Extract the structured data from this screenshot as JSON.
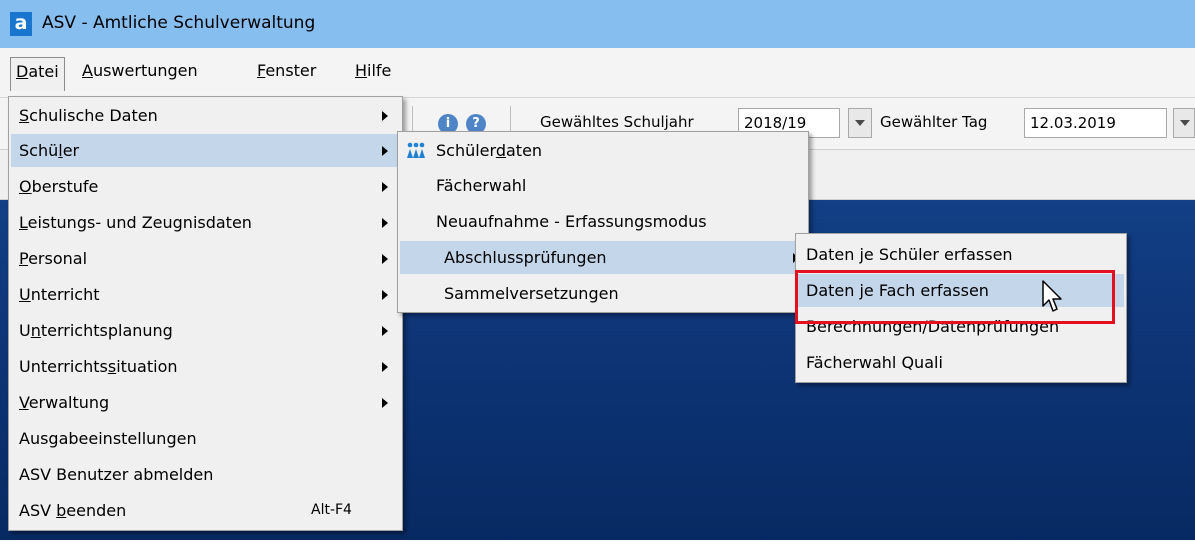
{
  "window": {
    "title": "ASV - Amtliche Schulverwaltung",
    "logo_letter": "a"
  },
  "menubar": {
    "items": [
      {
        "pre": "",
        "key": "D",
        "post": "atei"
      },
      {
        "pre": "",
        "key": "A",
        "post": "uswertungen"
      },
      {
        "pre": "",
        "key": "F",
        "post": "enster"
      },
      {
        "pre": "",
        "key": "H",
        "post": "ilfe"
      }
    ]
  },
  "toolbar": {
    "schuljahr_label": "Gewähltes Schuljahr",
    "schuljahr_value": "2018/19",
    "tag_label": "Gewählter Tag",
    "tag_value": "12.03.2019"
  },
  "datei_menu": [
    {
      "pre": "",
      "key": "S",
      "post": "chulische Daten",
      "submenu": true
    },
    {
      "pre": "Schü",
      "key": "l",
      "post": "er",
      "submenu": true
    },
    {
      "pre": "",
      "key": "O",
      "post": "berstufe",
      "submenu": true
    },
    {
      "pre": "",
      "key": "L",
      "post": "eistungs- und Zeugnisdaten",
      "submenu": true
    },
    {
      "pre": "",
      "key": "P",
      "post": "ersonal",
      "submenu": true
    },
    {
      "pre": "",
      "key": "U",
      "post": "nterricht",
      "submenu": true
    },
    {
      "pre": "U",
      "key": "n",
      "post": "terrichtsplanung",
      "submenu": true
    },
    {
      "pre": "Unterrichts",
      "key": "s",
      "post": "ituation",
      "submenu": true
    },
    {
      "pre": "",
      "key": "V",
      "post": "erwaltung",
      "submenu": true
    },
    {
      "pre": "Ausgabeeinstellungen",
      "key": "",
      "post": "",
      "submenu": false
    },
    {
      "pre": "ASV Benutzer abmelden",
      "key": "",
      "post": "",
      "submenu": false
    },
    {
      "pre": "ASV ",
      "key": "b",
      "post": "eenden",
      "submenu": false,
      "shortcut": "Alt-F4"
    }
  ],
  "schueler_menu": [
    {
      "pre": "Schüler",
      "key": "d",
      "post": "aten",
      "icon": "students-icon"
    },
    {
      "pre": "Fächerwahl",
      "key": "",
      "post": ""
    },
    {
      "pre": "Neuaufnahme - Erfassungsmodus",
      "key": "",
      "post": ""
    },
    {
      "pre": "Abschlussprüfungen",
      "key": "",
      "post": "",
      "submenu": true
    },
    {
      "pre": "Sammelversetzungen",
      "key": "",
      "post": ""
    }
  ],
  "abschluss_menu": [
    {
      "label": "Daten je Schüler erfassen"
    },
    {
      "label": "Daten je Fach erfassen"
    },
    {
      "label": "Berechnungen/Datenprüfungen"
    },
    {
      "label": "Fächerwahl Quali"
    }
  ],
  "colors": {
    "highlight": "#c4d6ea",
    "annotation": "#e3101e",
    "titlebar": "#87bef0"
  }
}
